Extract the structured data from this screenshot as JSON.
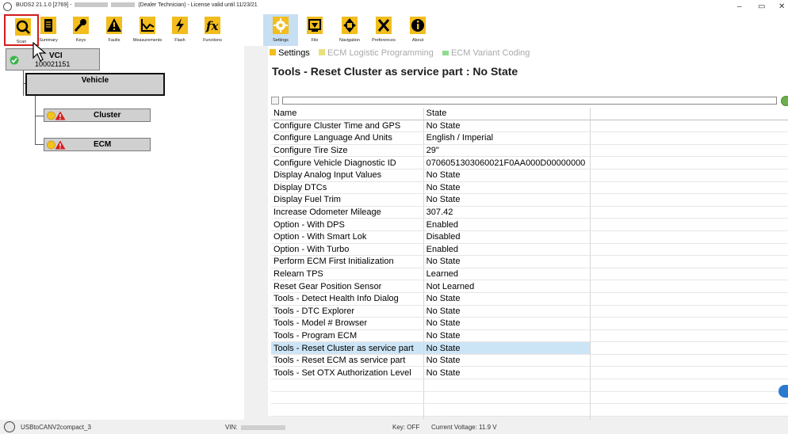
{
  "window": {
    "title_prefix": "BUDS2 21.1.0 [2769] -",
    "title_role": "(Dealer Technician)",
    "title_license": "- License valid until 11/23/21",
    "min_glyph": "–",
    "max_glyph": "▭",
    "close_glyph": "✕"
  },
  "toolbar": {
    "items": [
      {
        "label": "Scan",
        "icon": "scan-icon"
      },
      {
        "label": "Summary",
        "icon": "summary-icon"
      },
      {
        "label": "Keys",
        "icon": "key-icon"
      },
      {
        "label": "Faults",
        "icon": "warning-icon"
      },
      {
        "label": "Measurements",
        "icon": "chart-icon"
      },
      {
        "label": "Flash",
        "icon": "lightning-icon"
      },
      {
        "label": "Functions",
        "icon": "fx-icon"
      },
      {
        "label": "Settings",
        "icon": "gear-icon"
      },
      {
        "label": "File",
        "icon": "file-icon"
      },
      {
        "label": "Navigation",
        "icon": "arrows-icon"
      },
      {
        "label": "Preferences",
        "icon": "tools-icon"
      },
      {
        "label": "About",
        "icon": "info-icon"
      }
    ],
    "selected": "Settings"
  },
  "tree": {
    "vci": {
      "label": "VCI",
      "id": "100021151"
    },
    "vehicle": {
      "label": "Vehicle"
    },
    "modules": [
      {
        "label": "Cluster"
      },
      {
        "label": "ECM"
      }
    ]
  },
  "breadcrumbs": [
    {
      "label": "Settings",
      "active": true
    },
    {
      "label": "ECM Logistic Programming",
      "active": false
    },
    {
      "label": "ECM Variant Coding",
      "active": false
    }
  ],
  "page_title": "Tools - Reset Cluster as service part : No State",
  "filter": {
    "value": ""
  },
  "grid": {
    "columns": [
      "Name",
      "State"
    ],
    "rows": [
      {
        "name": "Configure Cluster Time and GPS",
        "state": "No State"
      },
      {
        "name": "Configure Language And Units",
        "state": "English / Imperial"
      },
      {
        "name": "Configure Tire Size",
        "state": "29\""
      },
      {
        "name": "Configure Vehicle Diagnostic ID",
        "state": "0706051303060021F0AA000D00000000"
      },
      {
        "name": "Display Analog Input Values",
        "state": "No State"
      },
      {
        "name": "Display DTCs",
        "state": "No State"
      },
      {
        "name": "Display Fuel Trim",
        "state": "No State"
      },
      {
        "name": "Increase Odometer Mileage",
        "state": "307.42"
      },
      {
        "name": "Option - With DPS",
        "state": "Enabled"
      },
      {
        "name": "Option - With Smart Lok",
        "state": "Disabled"
      },
      {
        "name": "Option - With Turbo",
        "state": "Enabled"
      },
      {
        "name": "Perform ECM First Initialization",
        "state": "No State"
      },
      {
        "name": "Relearn TPS",
        "state": "Learned"
      },
      {
        "name": "Reset Gear Position Sensor",
        "state": "Not Learned"
      },
      {
        "name": "Tools - Detect Health Info Dialog",
        "state": "No State"
      },
      {
        "name": "Tools - DTC Explorer",
        "state": "No State"
      },
      {
        "name": "Tools - Model # Browser",
        "state": "No State"
      },
      {
        "name": "Tools - Program ECM",
        "state": "No State"
      },
      {
        "name": "Tools - Reset Cluster as service part",
        "state": "No State"
      },
      {
        "name": "Tools - Reset ECM as service part",
        "state": "No State"
      },
      {
        "name": "Tools - Set OTX Authorization Level",
        "state": "No State"
      }
    ],
    "selected_row": "Tools - Reset Cluster as service part"
  },
  "status": {
    "adapter": "USBtoCANV2compact_3",
    "vin_label": "VIN:",
    "key": "Key: OFF",
    "voltage": "Current Voltage: 11.9 V"
  },
  "colors": {
    "selected_toolbar": "#c7dff2",
    "selected_row": "#cce5f6",
    "scan_highlight": "#d21c1c",
    "ok_green": "#3bb54a",
    "warning_red": "#d61f1f",
    "caution_yellow": "#f4c21b"
  }
}
